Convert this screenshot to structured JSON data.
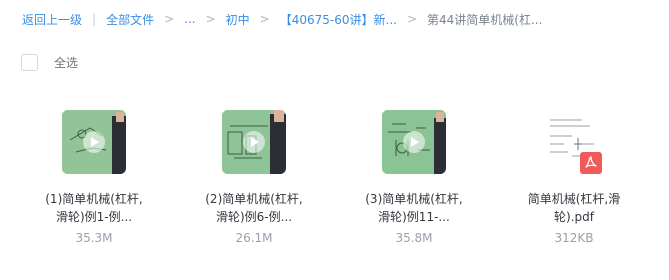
{
  "breadcrumb": {
    "back": "返回上一级",
    "divider": "|",
    "items": [
      "全部文件",
      "...",
      "初中",
      "【40675-60讲】新...",
      "第44讲简单机械(杠..."
    ],
    "separator": ">"
  },
  "select_all": {
    "label": "全选",
    "checked": false
  },
  "files": [
    {
      "name_line1": "(1)简单机械(杠杆,",
      "name_line2": "滑轮)例1-例...",
      "size": "35.3M",
      "type": "video",
      "icon": "play-icon"
    },
    {
      "name_line1": "(2)简单机械(杠杆,",
      "name_line2": "滑轮)例6-例...",
      "size": "26.1M",
      "type": "video",
      "icon": "play-icon"
    },
    {
      "name_line1": "(3)简单机械(杠杆,",
      "name_line2": "滑轮)例11-...",
      "size": "35.8M",
      "type": "video",
      "icon": "play-icon"
    },
    {
      "name_line1": "简单机械(杠杆,滑",
      "name_line2": "轮).pdf",
      "size": "312KB",
      "type": "pdf",
      "icon": "pdf-icon"
    }
  ],
  "colors": {
    "link": "#3a8ee6",
    "pdf_badge": "#f05a5a",
    "video_board": "#7fb98a"
  }
}
